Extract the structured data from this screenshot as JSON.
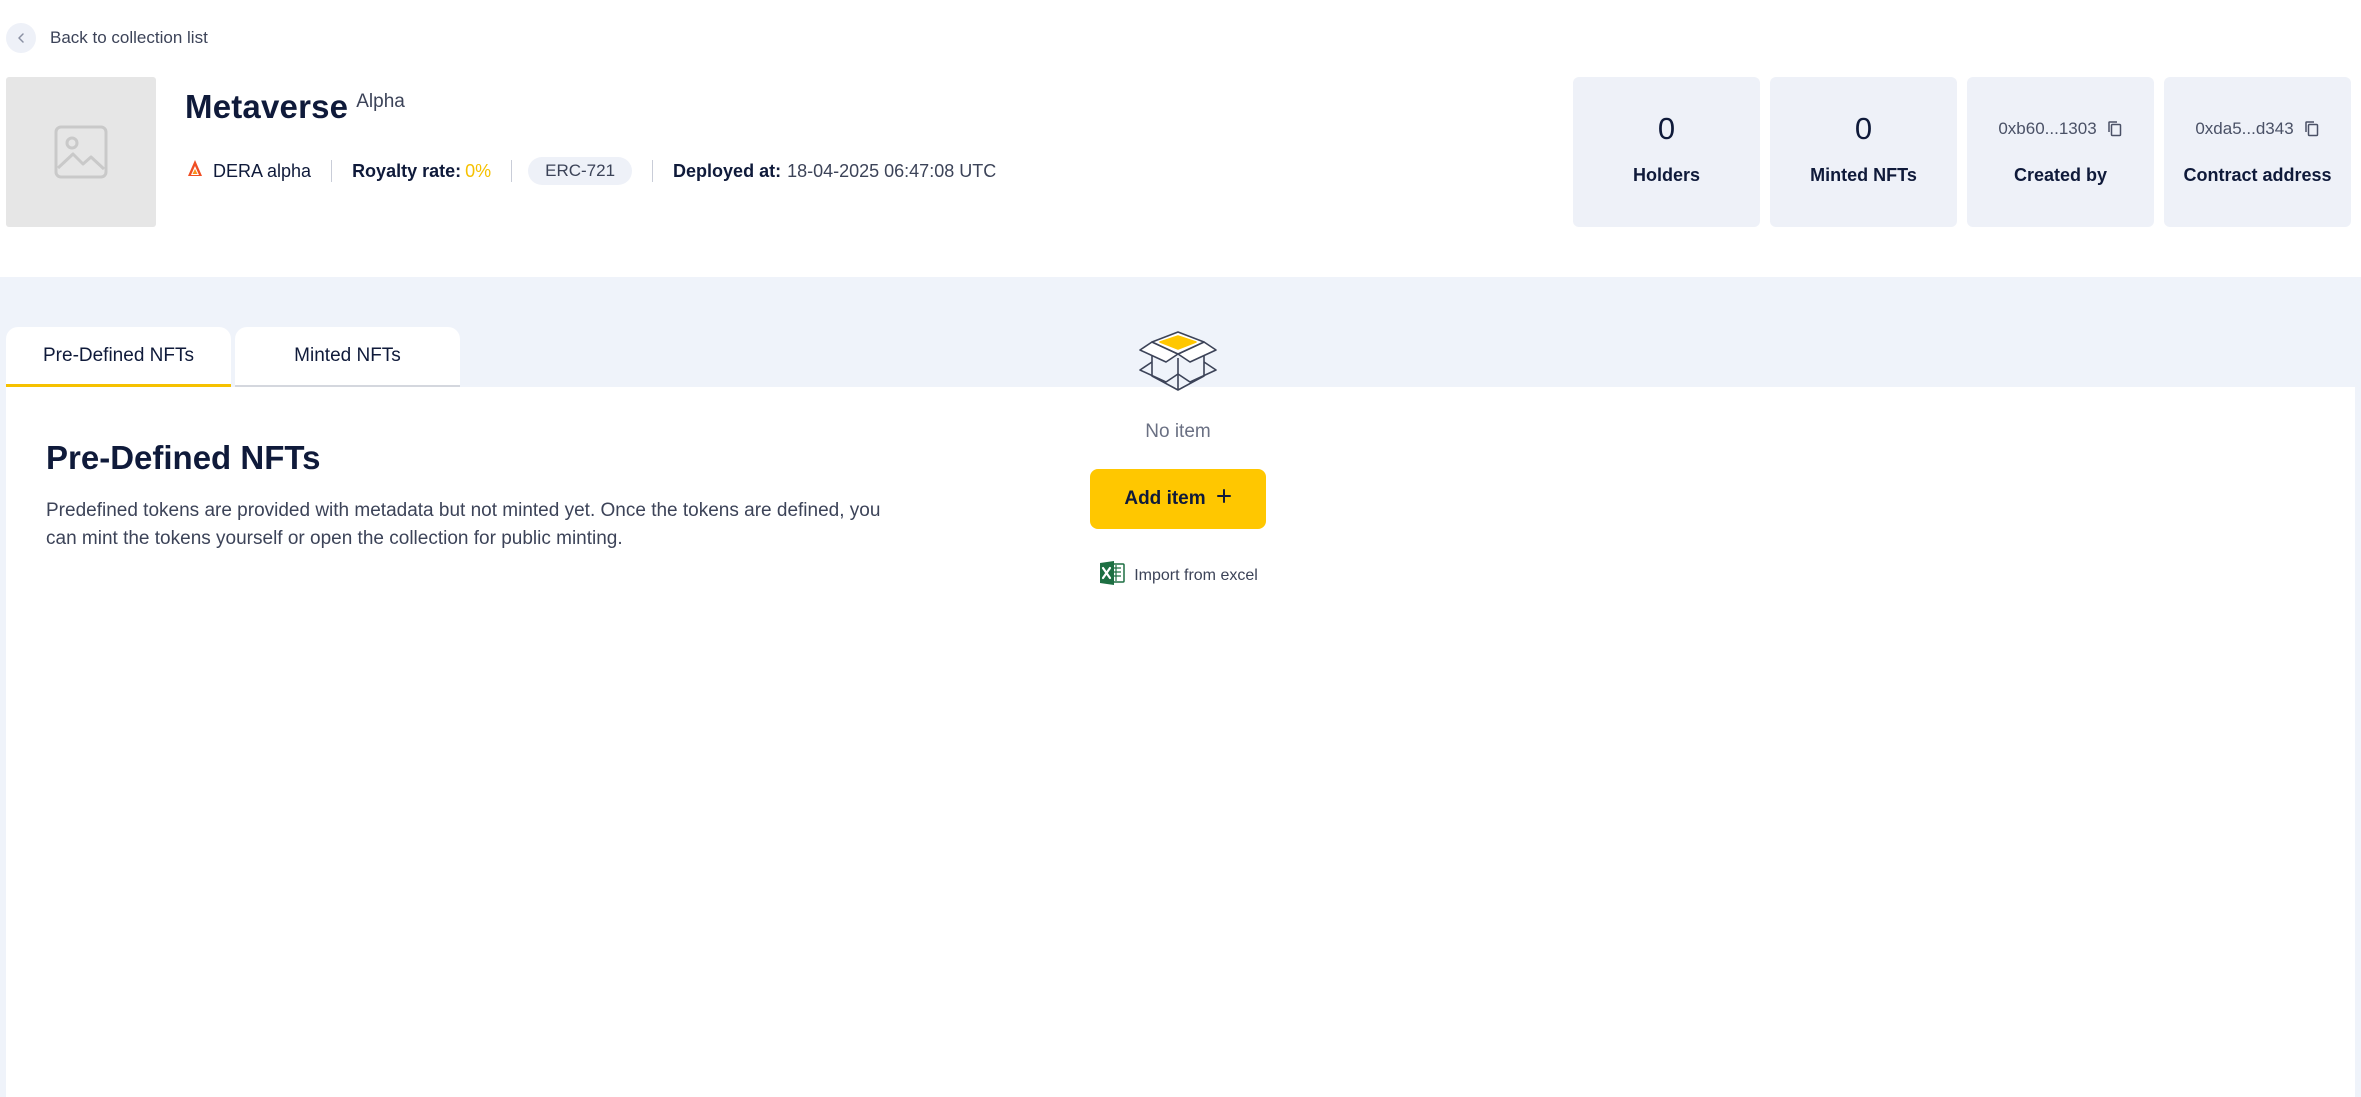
{
  "back": {
    "label": "Back to collection list"
  },
  "collection": {
    "name": "Metaverse",
    "badge": "Alpha",
    "chain": "DERA alpha",
    "royalty_label": "Royalty rate:",
    "royalty_value": "0%",
    "standard": "ERC-721",
    "deployed_label": "Deployed at:",
    "deployed_value": "18-04-2025 06:47:08 UTC"
  },
  "stats": {
    "holders_value": "0",
    "holders_label": "Holders",
    "minted_value": "0",
    "minted_label": "Minted NFTs",
    "creator_value": "0xb60...1303",
    "creator_label": "Created by",
    "contract_value": "0xda5...d343",
    "contract_label": "Contract address"
  },
  "tabs": [
    {
      "label": "Pre-Defined NFTs"
    },
    {
      "label": "Minted NFTs"
    }
  ],
  "panel": {
    "title": "Pre-Defined NFTs",
    "description": "Predefined tokens are provided with metadata but not minted yet. Once the tokens are defined, you can mint the tokens yourself or open the collection for public minting."
  },
  "empty_state": {
    "message": "No item",
    "add_label": "Add item",
    "import_label": "Import from excel"
  },
  "colors": {
    "accent": "#ffc700",
    "text_dark": "#0f1a3a",
    "card_bg": "#eef1f8",
    "page_bg_lower": "#eff3fa",
    "excel_green": "#1d6f42"
  }
}
